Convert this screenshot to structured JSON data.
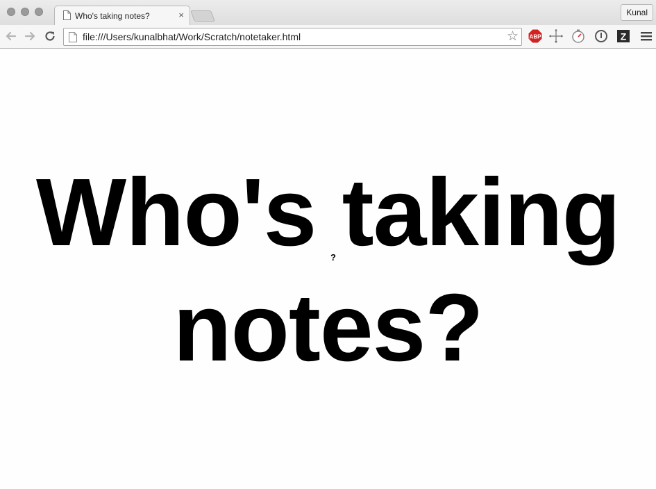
{
  "browser": {
    "tab": {
      "title": "Who's taking notes?",
      "close_glyph": "×"
    },
    "profile_label": "Kunal",
    "omnibox": {
      "url": "file:///Users/kunalbhat/Work/Scratch/notetaker.html",
      "star_glyph": "☆"
    },
    "extensions": [
      {
        "name": "adblock-plus-icon",
        "label": "ABP",
        "color": "#d22222"
      },
      {
        "name": "move-cross-icon"
      },
      {
        "name": "stopwatch-icon"
      },
      {
        "name": "info-circle-icon"
      },
      {
        "name": "zotero-icon",
        "label": "Z",
        "color": "#2b2b2b"
      },
      {
        "name": "hamburger-menu-icon"
      }
    ]
  },
  "page": {
    "headline": "Who's taking notes?",
    "cursor_glyph": "?"
  }
}
